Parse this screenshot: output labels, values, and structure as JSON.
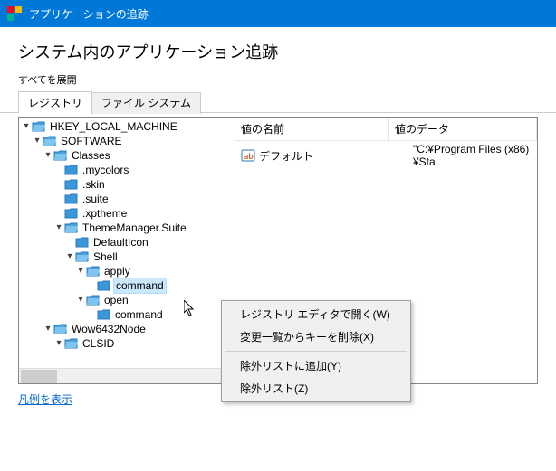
{
  "title": "アプリケーションの追跡",
  "heading": "システム内のアプリケーション追跡",
  "expand_all": "すべてを展開",
  "tabs": {
    "registry": "レジストリ",
    "filesystem": "ファイル システム"
  },
  "tree": {
    "root": "HKEY_LOCAL_MACHINE",
    "software": "SOFTWARE",
    "classes": "Classes",
    "mycolors": ".mycolors",
    "skin": ".skin",
    "suite": ".suite",
    "xptheme": ".xptheme",
    "thememanager": "ThemeManager.Suite",
    "defaulticon": "DefaultIcon",
    "shell": "Shell",
    "apply": "apply",
    "command1": "command",
    "open": "open",
    "command2": "command",
    "wow64": "Wow6432Node",
    "clsid": "CLSID"
  },
  "columns": {
    "name": "値の名前",
    "data": "値のデータ"
  },
  "rows": [
    {
      "name": "デフォルト",
      "data": "\"C:¥Program Files (x86)¥Sta"
    }
  ],
  "legend": "凡例を表示",
  "ctx": {
    "open_editor": "レジストリ エディタで開く(W)",
    "remove_key": "変更一覧からキーを削除(X)",
    "add_exclude": "除外リストに追加(Y)",
    "exclude_list": "除外リスト(Z)"
  }
}
